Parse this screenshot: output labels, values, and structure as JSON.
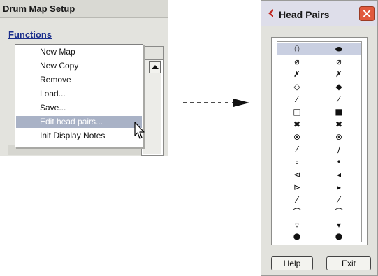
{
  "drum_map_setup": {
    "title": "Drum Map Setup",
    "functions_label": "Functions",
    "menu_items": [
      {
        "label": "New Map",
        "highlighted": false
      },
      {
        "label": "New Copy",
        "highlighted": false
      },
      {
        "label": "Remove",
        "highlighted": false
      },
      {
        "label": "Load...",
        "highlighted": false
      },
      {
        "label": "Save...",
        "highlighted": false
      },
      {
        "label": "Edit head pairs...",
        "highlighted": true
      },
      {
        "label": "Init Display Notes",
        "highlighted": false
      }
    ]
  },
  "head_pairs": {
    "title": "Head Pairs",
    "rows": [
      {
        "open": "⬯",
        "closed": "⬬",
        "selected": true
      },
      {
        "open": "⌀",
        "closed": "⌀",
        "selected": false
      },
      {
        "open": "✗",
        "closed": "✗",
        "selected": false
      },
      {
        "open": "◇",
        "closed": "◆",
        "selected": false
      },
      {
        "open": "⁄",
        "closed": "⁄",
        "selected": false
      },
      {
        "open": "□",
        "closed": "■",
        "selected": false
      },
      {
        "open": "✖",
        "closed": "✖",
        "selected": false
      },
      {
        "open": "⊗",
        "closed": "⊗",
        "selected": false
      },
      {
        "open": "⁄",
        "closed": "∕",
        "selected": false
      },
      {
        "open": "∘",
        "closed": "•",
        "selected": false
      },
      {
        "open": "⊲",
        "closed": "◂",
        "selected": false
      },
      {
        "open": "⊳",
        "closed": "▸",
        "selected": false
      },
      {
        "open": "⁄",
        "closed": "⁄",
        "selected": false
      },
      {
        "open": "⌒",
        "closed": "⌒",
        "selected": false
      },
      {
        "open": "▿",
        "closed": "▾",
        "selected": false
      },
      {
        "open": "●",
        "closed": "●",
        "selected": false
      }
    ],
    "help_label": "Help",
    "exit_label": "Exit"
  },
  "colors": {
    "selection": "#c9cfe1",
    "menu_highlight": "#a9b2c6",
    "close_button": "#e15a3e",
    "link": "#1b2f8c",
    "logo": "#c0261f"
  }
}
